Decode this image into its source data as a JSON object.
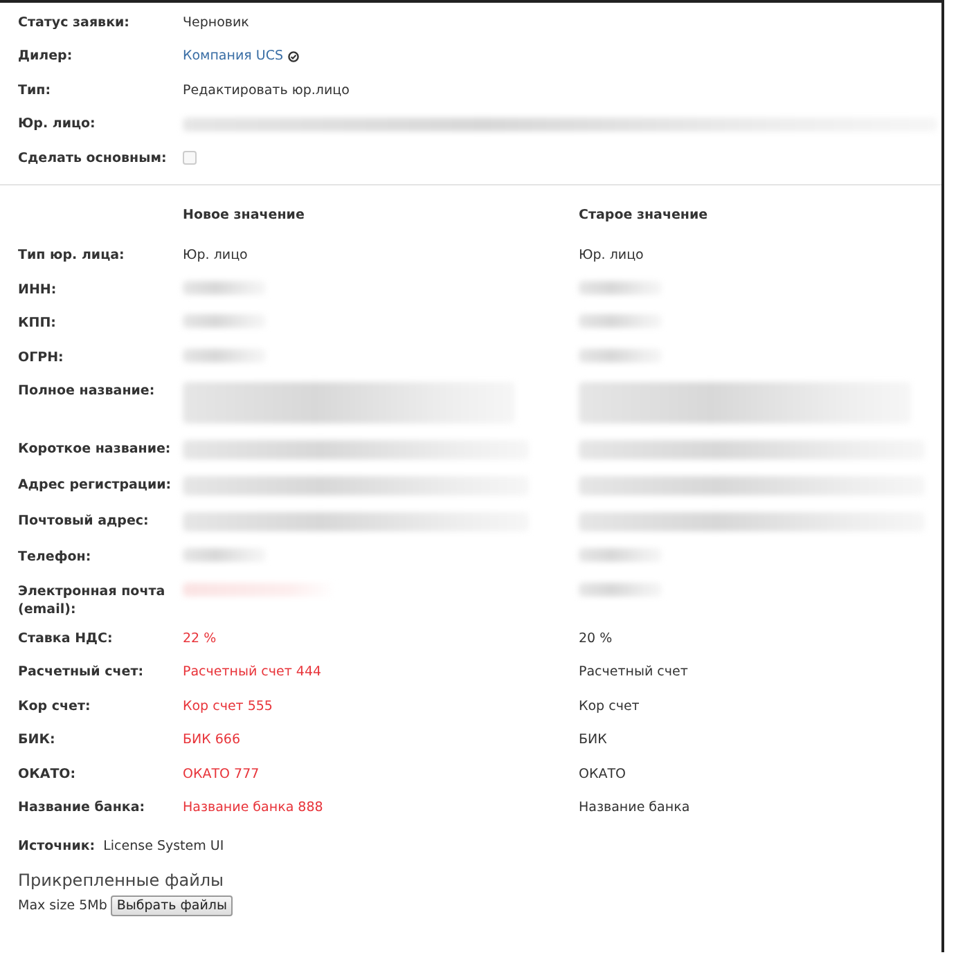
{
  "summary": [
    {
      "label": "Статус заявки:",
      "kind": "text",
      "value": "Черновик"
    },
    {
      "label": "Дилер:",
      "kind": "link",
      "value": "Компания UCS"
    },
    {
      "label": "Тип:",
      "kind": "text",
      "value": "Редактировать юр.лицо"
    },
    {
      "label": "Юр. лицо:",
      "kind": "redacted-wide"
    },
    {
      "label": "Сделать основным:",
      "kind": "checkbox",
      "checked": false
    }
  ],
  "compare": {
    "new_heading": "Новое значение",
    "old_heading": "Старое значение",
    "rows": [
      {
        "label": "Тип юр. лица:",
        "new": {
          "kind": "text",
          "value": "Юр. лицо",
          "changed": false
        },
        "old": {
          "kind": "text",
          "value": "Юр. лицо"
        }
      },
      {
        "label": "ИНН:",
        "new": {
          "kind": "redacted-short",
          "changed": false
        },
        "old": {
          "kind": "redacted-short"
        }
      },
      {
        "label": "КПП:",
        "new": {
          "kind": "redacted-short",
          "changed": false
        },
        "old": {
          "kind": "redacted-short"
        }
      },
      {
        "label": "ОГРН:",
        "new": {
          "kind": "redacted-short",
          "changed": false
        },
        "old": {
          "kind": "redacted-short"
        }
      },
      {
        "label": "Полное название:",
        "new": {
          "kind": "redacted-block",
          "changed": false
        },
        "old": {
          "kind": "redacted-block"
        }
      },
      {
        "label": "Короткое название:",
        "new": {
          "kind": "redacted-long",
          "changed": false
        },
        "old": {
          "kind": "redacted-long"
        }
      },
      {
        "label": "Адрес регистрации:",
        "new": {
          "kind": "redacted-long",
          "changed": false
        },
        "old": {
          "kind": "redacted-long"
        }
      },
      {
        "label": "Почтовый адрес:",
        "new": {
          "kind": "redacted-long",
          "changed": false
        },
        "old": {
          "kind": "redacted-long"
        }
      },
      {
        "label": "Телефон:",
        "new": {
          "kind": "redacted-short",
          "changed": false
        },
        "old": {
          "kind": "redacted-short"
        }
      },
      {
        "label": "Электронная почта (email):",
        "new": {
          "kind": "redacted-short",
          "changed": true
        },
        "old": {
          "kind": "redacted-short"
        }
      },
      {
        "label": "Ставка НДС:",
        "new": {
          "kind": "text",
          "value": "22 %",
          "changed": true
        },
        "old": {
          "kind": "text",
          "value": "20 %"
        }
      },
      {
        "label": "Расчетный счет:",
        "new": {
          "kind": "text",
          "value": "Расчетный счет 444",
          "changed": true
        },
        "old": {
          "kind": "text",
          "value": "Расчетный счет"
        }
      },
      {
        "label": "Кор счет:",
        "new": {
          "kind": "text",
          "value": "Кор счет 555",
          "changed": true
        },
        "old": {
          "kind": "text",
          "value": "Кор счет"
        }
      },
      {
        "label": "БИК:",
        "new": {
          "kind": "text",
          "value": "БИК 666",
          "changed": true
        },
        "old": {
          "kind": "text",
          "value": "БИК"
        }
      },
      {
        "label": "ОКАТО:",
        "new": {
          "kind": "text",
          "value": "ОКАТО 777",
          "changed": true
        },
        "old": {
          "kind": "text",
          "value": "ОКАТО"
        }
      },
      {
        "label": "Название банка:",
        "new": {
          "kind": "text",
          "value": "Название банка 888",
          "changed": true
        },
        "old": {
          "kind": "text",
          "value": "Название банка"
        }
      }
    ]
  },
  "source": {
    "label": "Источник:",
    "value": "License System UI"
  },
  "attachments": {
    "title": "Прикрепленные файлы",
    "max_size": "Max size 5Mb",
    "button": "Выбрать файлы"
  }
}
